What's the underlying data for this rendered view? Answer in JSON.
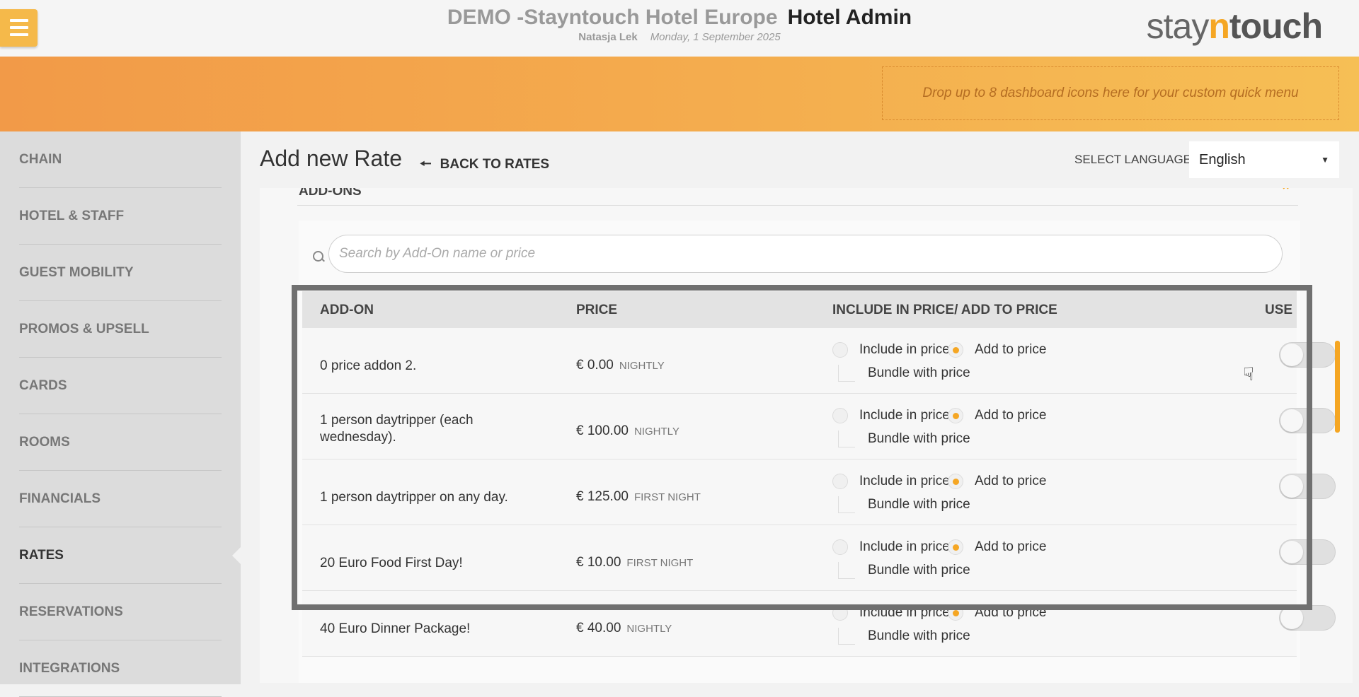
{
  "header": {
    "hotel_name": "DEMO -Stayntouch Hotel Europe",
    "app_name": "Hotel Admin",
    "user": "Natasja Lek",
    "date": "Monday, 1 September 2025",
    "logo_pre": "stay",
    "logo_n": "n",
    "logo_post": "touch"
  },
  "banner": {
    "dropzone_text": "Drop up to 8 dashboard icons here for your custom quick menu"
  },
  "sidebar": {
    "items": [
      {
        "label": "CHAIN"
      },
      {
        "label": "HOTEL & STAFF"
      },
      {
        "label": "GUEST MOBILITY"
      },
      {
        "label": "PROMOS & UPSELL"
      },
      {
        "label": "CARDS"
      },
      {
        "label": "ROOMS"
      },
      {
        "label": "FINANCIALS"
      },
      {
        "label": "RATES"
      },
      {
        "label": "RESERVATIONS"
      },
      {
        "label": "INTEGRATIONS"
      }
    ],
    "active": "RATES"
  },
  "main": {
    "title": "Add new Rate",
    "back_label": "BACK TO RATES",
    "language_label": "SELECT LANGUAGE",
    "language_value": "English",
    "section_title": "ADD-ONS",
    "search_placeholder": "Search by Add-On name or price"
  },
  "table": {
    "headers": {
      "addon": "ADD-ON",
      "price": "PRICE",
      "include": "INCLUDE IN PRICE/ ADD TO PRICE",
      "use": "USE"
    },
    "option_labels": {
      "include": "Include in price",
      "add": "Add to price",
      "bundle": "Bundle with price"
    },
    "rows": [
      {
        "name": "0 price addon 2.",
        "price": "€ 0.00",
        "frequency": "NIGHTLY",
        "add_to_price": true,
        "bundle": false,
        "use": false
      },
      {
        "name": "1 person daytripper (each wednesday).",
        "price": "€ 100.00",
        "frequency": "NIGHTLY",
        "add_to_price": true,
        "bundle": false,
        "use": false
      },
      {
        "name": "1 person daytripper on any day.",
        "price": "€ 125.00",
        "frequency": "FIRST NIGHT",
        "add_to_price": true,
        "bundle": false,
        "use": false
      },
      {
        "name": "20 Euro Food First Day!",
        "price": "€ 10.00",
        "frequency": "FIRST NIGHT",
        "add_to_price": true,
        "bundle": false,
        "use": false
      },
      {
        "name": "40 Euro Dinner Package!",
        "price": "€ 40.00",
        "frequency": "NIGHTLY",
        "add_to_price": true,
        "bundle": false,
        "use": false
      }
    ]
  },
  "colors": {
    "accent": "#f5a623",
    "banner_start": "#f29a48",
    "banner_end": "#f6bf55",
    "sidebar_bg": "#dcdcdc"
  }
}
